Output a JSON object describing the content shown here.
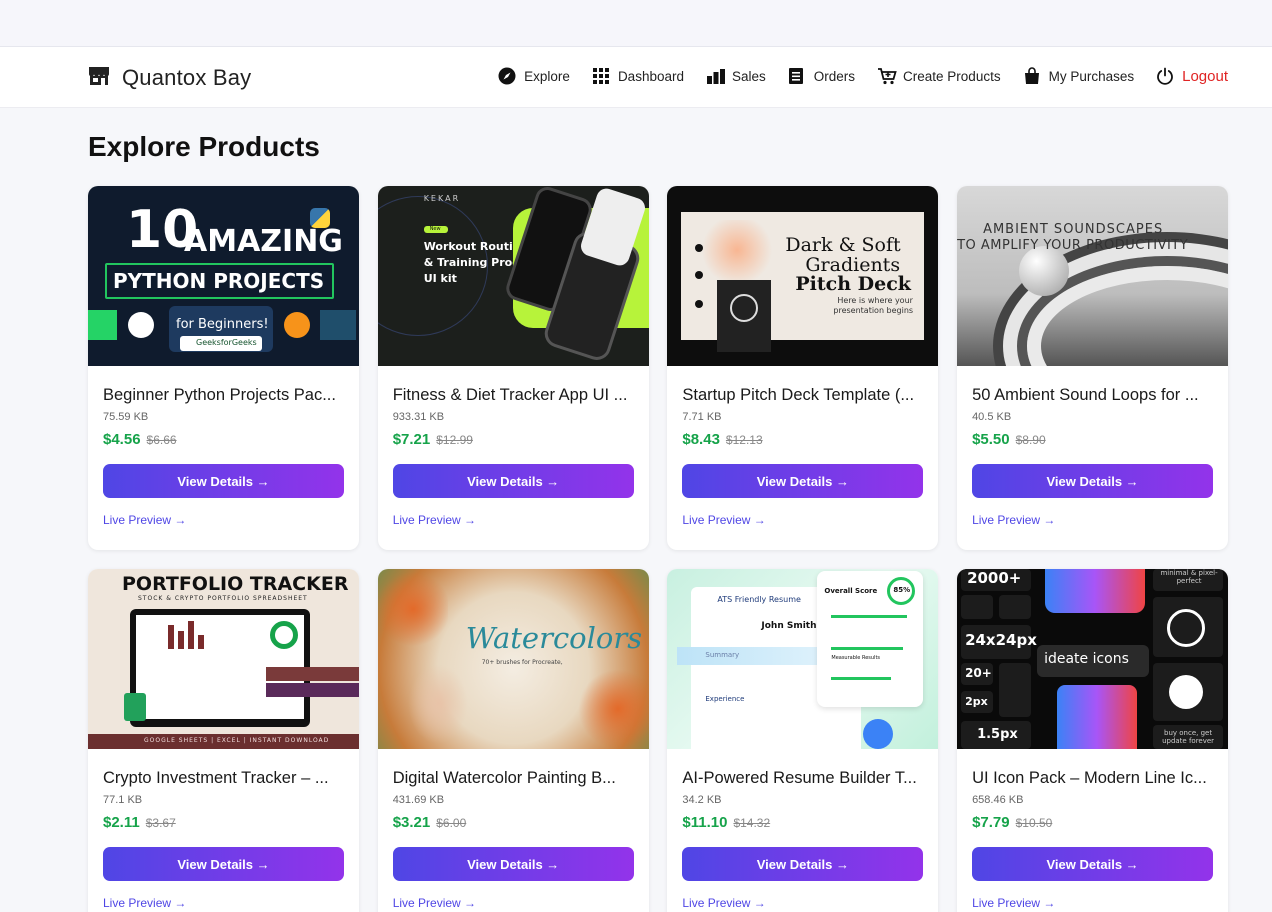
{
  "app": {
    "name": "Quantox Bay"
  },
  "nav": [
    {
      "label": "Explore",
      "icon": "compass-icon"
    },
    {
      "label": "Dashboard",
      "icon": "grid-icon"
    },
    {
      "label": "Sales",
      "icon": "bar-chart-icon"
    },
    {
      "label": "Orders",
      "icon": "receipt-icon"
    },
    {
      "label": "Create Products",
      "icon": "cart-plus-icon"
    },
    {
      "label": "My Purchases",
      "icon": "shopping-bag-icon"
    },
    {
      "label": "Logout",
      "icon": "power-icon"
    }
  ],
  "page": {
    "title": "Explore Products"
  },
  "colors": {
    "accent_start": "#4f46e5",
    "accent_end": "#9333ea",
    "price": "#16a34a",
    "logout": "#e02424"
  },
  "products": [
    {
      "title": "Beginner Python Projects Pac...",
      "size": "75.59 KB",
      "price": "$4.56",
      "old_price": "$6.66",
      "button": "View Details →",
      "preview": "Live Preview →",
      "thumb": {
        "line1": "10",
        "line2": "AMAZING",
        "line3": "PYTHON PROJECTS",
        "line4": "for Beginners!",
        "badge": "GeeksforGeeks"
      }
    },
    {
      "title": "Fitness & Diet Tracker App UI ...",
      "size": "933.31 KB",
      "price": "$7.21",
      "old_price": "$12.99",
      "button": "View Details →",
      "preview": "Live Preview →",
      "thumb": {
        "brand": "KEKAR",
        "tag": "New",
        "line1": "Workout Routines",
        "line2": "& Training Programs",
        "line3": "UI kit"
      }
    },
    {
      "title": "Startup Pitch Deck Template (...",
      "size": "7.71 KB",
      "price": "$8.43",
      "old_price": "$12.13",
      "button": "View Details →",
      "preview": "Live Preview →",
      "thumb": {
        "line1": "Dark & Soft",
        "line2": "Gradients",
        "line3": "Pitch Deck",
        "line4": "Here is where your",
        "line5": "presentation begins"
      }
    },
    {
      "title": "50 Ambient Sound Loops for ...",
      "size": "40.5 KB",
      "price": "$5.50",
      "old_price": "$8.90",
      "button": "View Details →",
      "preview": "Live Preview →",
      "thumb": {
        "line1": "AMBIENT SOUNDSCAPES",
        "line2": "TO AMPLIFY YOUR PRODUCTIVITY"
      }
    },
    {
      "title": "Crypto Investment Tracker – ...",
      "size": "77.1 KB",
      "price": "$2.11",
      "old_price": "$3.67",
      "button": "View Details →",
      "preview": "Live Preview →",
      "thumb": {
        "line1": "PORTFOLIO TRACKER",
        "line2": "STOCK & CRYPTO PORTFOLIO SPREADSHEET",
        "line3": "GOOGLE SHEETS | EXCEL | INSTANT DOWNLOAD"
      }
    },
    {
      "title": "Digital Watercolor Painting B...",
      "size": "431.69 KB",
      "price": "$3.21",
      "old_price": "$6.00",
      "button": "View Details →",
      "preview": "Live Preview →",
      "thumb": {
        "line1": "Watercolors",
        "line2": "70+ brushes for Procreate,"
      }
    },
    {
      "title": "AI-Powered Resume Builder T...",
      "size": "34.2 KB",
      "price": "$11.10",
      "old_price": "$14.32",
      "button": "View Details →",
      "preview": "Live Preview →",
      "thumb": {
        "line1": "ATS Friendly Resume",
        "line2": "John Smith",
        "line3": "Summary",
        "line4": "Experience",
        "line5": "Overall Score",
        "line6": "85%",
        "line7": "Measurable Results"
      }
    },
    {
      "title": "UI Icon Pack – Modern Line Ic...",
      "size": "658.46 KB",
      "price": "$7.79",
      "old_price": "$10.50",
      "button": "View Details →",
      "preview": "Live Preview →",
      "thumb": {
        "line1": "2000+",
        "line2": "24x24px",
        "line3": "ideate icons",
        "line4": "20+",
        "line5": "2px",
        "line6": "1.5px",
        "line7": "minimal & pixel-perfect",
        "line8": "buy once, get update forever"
      }
    }
  ]
}
